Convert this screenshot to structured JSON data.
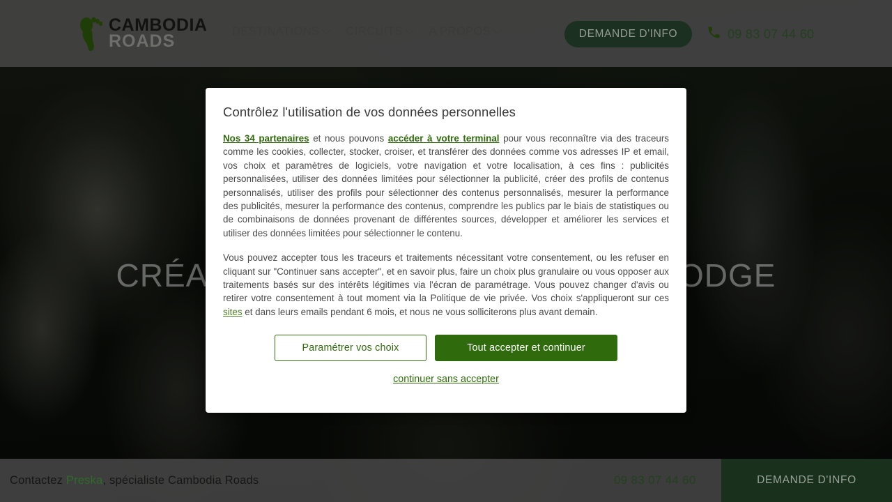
{
  "header": {
    "logo": {
      "icon": "footprint-icon",
      "word_top": "CAMBODIA",
      "word_bottom": "ROADS"
    },
    "nav": [
      {
        "label": "DESTINATIONS",
        "icon": "chevron-down-icon"
      },
      {
        "label": "CIRCUITS",
        "icon": "chevron-down-icon"
      },
      {
        "label": "A PROPOS",
        "icon": "chevron-down-icon"
      }
    ],
    "cta_label": "DEMANDE D'INFO",
    "phone_icon": "phone-icon",
    "phone": "09 83 07 44 60"
  },
  "hero": {
    "title": "CRÉATEUR DE VOYAGES AU CAMBODGE"
  },
  "modal": {
    "title": "Contrôlez l'utilisation de vos données personnelles",
    "p1": {
      "link1": "Nos 34 partenaires",
      "mid1": " et nous pouvons ",
      "link2": "accéder à votre terminal",
      "rest": " pour vous reconnaître via des traceurs comme les cookies, collecter, stocker, croiser, et transférer des données comme vos adresses IP et email, vos choix et paramètres de logiciels, votre navigation et votre localisation, à ces fins : publicités personnalisées, utiliser des données limitées pour sélectionner la publicité, créer des profils de contenus personnalisés, utiliser des profils pour sélectionner des contenus personnalisés, mesurer la performance des publicités, mesurer la performance des contenus, comprendre les publics par le biais de statistiques ou de combinaisons de données provenant de différentes sources, développer et améliorer les services et utiliser des données limitées pour sélectionner le contenu."
    },
    "p2": {
      "before": "Vous pouvez accepter tous les traceurs et traitements nécessitant votre consentement, ou les refuser en cliquant sur \"Continuer sans accepter\", et en savoir plus, faire un choix plus granulaire ou vous opposer aux traitements basés sur des intérêts légitimes via l'écran de paramétrage. Vous pouvez changer d'avis ou retirer votre consentement à tout moment via la Politique de vie privée. Vos choix s'appliqueront sur ces ",
      "link": "sites",
      "after": " et dans leurs emails pendant 6 mois, et nous ne vous solliciterons plus avant demain."
    },
    "settings_label": "Paramétrer vos choix",
    "accept_label": "Tout accepter et continuer",
    "refuse_label": "continuer sans accepter"
  },
  "bottombar": {
    "text_before": "Contactez ",
    "highlight": "Preska",
    "text_after": ", spécialiste Cambodia Roads",
    "phone": "09 83 07 44 60",
    "cta_label": "DEMANDE D'INFO"
  },
  "colors": {
    "brand_green": "#2f6b0c",
    "dark_green": "#18301c",
    "bar_gray": "#464646"
  }
}
